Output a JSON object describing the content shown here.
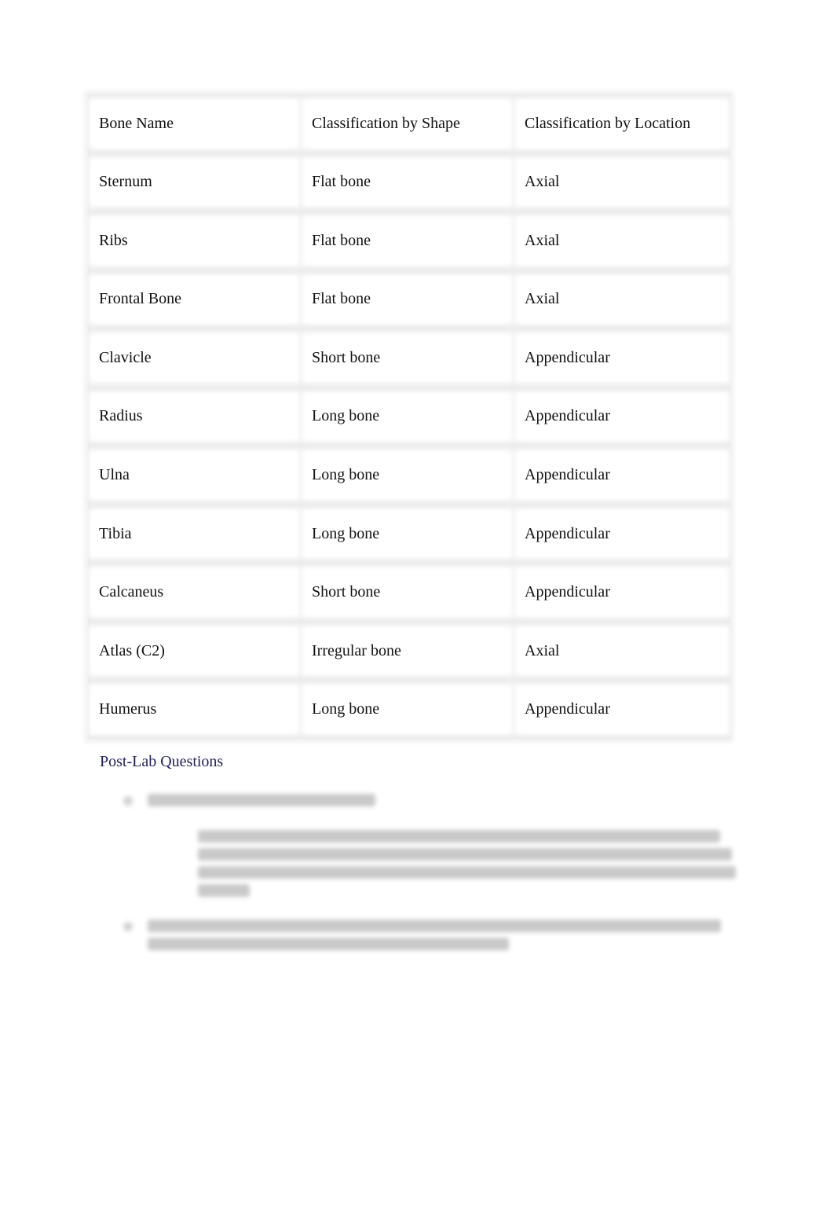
{
  "table": {
    "headers": [
      "Bone Name",
      "Classification by Shape",
      "Classification by Location"
    ],
    "rows": [
      [
        "Sternum",
        "Flat bone",
        "Axial"
      ],
      [
        "Ribs",
        "Flat bone",
        "Axial"
      ],
      [
        "Frontal Bone",
        "Flat bone",
        "Axial"
      ],
      [
        "Clavicle",
        "Short bone",
        "Appendicular"
      ],
      [
        "Radius",
        "Long bone",
        "Appendicular"
      ],
      [
        "Ulna",
        "Long bone",
        "Appendicular"
      ],
      [
        "Tibia",
        "Long bone",
        "Appendicular"
      ],
      [
        "Calcaneus",
        "Short bone",
        "Appendicular"
      ],
      [
        "Atlas (C2)",
        "Irregular bone",
        "Axial"
      ],
      [
        "Humerus",
        "Long bone",
        "Appendicular"
      ]
    ]
  },
  "post_lab": {
    "heading": "Post-Lab Questions",
    "heading_color": "#1f1f5a",
    "questions_obscured": true
  }
}
